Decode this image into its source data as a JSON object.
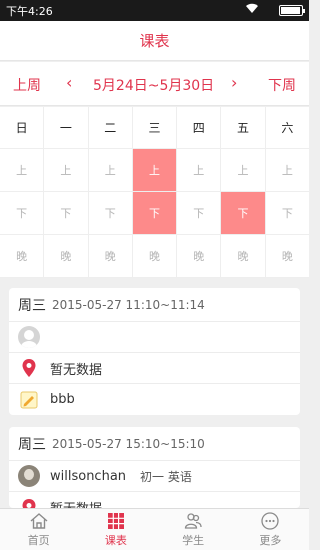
{
  "status": {
    "time": "下午4:26",
    "wifi_icon": "wifi-icon",
    "battery_icon": "battery-icon",
    "battery_level": 0.95
  },
  "title": "课表",
  "week": {
    "prev": "上周",
    "range": "5月24日~5月30日",
    "next": "下周"
  },
  "grid": {
    "days": [
      "日",
      "一",
      "二",
      "三",
      "四",
      "五",
      "六"
    ],
    "rows": [
      {
        "label": "上",
        "active": [
          false,
          false,
          false,
          true,
          false,
          false,
          false
        ]
      },
      {
        "label": "下",
        "active": [
          false,
          false,
          false,
          true,
          false,
          true,
          false
        ]
      },
      {
        "label": "晚",
        "active": [
          false,
          false,
          false,
          false,
          false,
          false,
          false
        ]
      }
    ],
    "active_color": "#fd8a8a"
  },
  "cards": [
    {
      "day": "周三",
      "datetime": "2015-05-27 11:10~11:14",
      "teacher": "",
      "location": "暂无数据",
      "note": "bbb"
    },
    {
      "day": "周三",
      "datetime": "2015-05-27 15:10~15:10",
      "teacher": "willsonchan",
      "grade_subject": "初一 英语",
      "location": "暂无数据"
    }
  ],
  "tabs": [
    {
      "label": "首页",
      "icon": "home-icon"
    },
    {
      "label": "课表",
      "icon": "calendar-grid-icon",
      "active": true
    },
    {
      "label": "学生",
      "icon": "students-icon"
    },
    {
      "label": "更多",
      "icon": "more-icon"
    }
  ],
  "colors": {
    "accent": "#e0344d",
    "active_cell": "#fd8a8a"
  }
}
